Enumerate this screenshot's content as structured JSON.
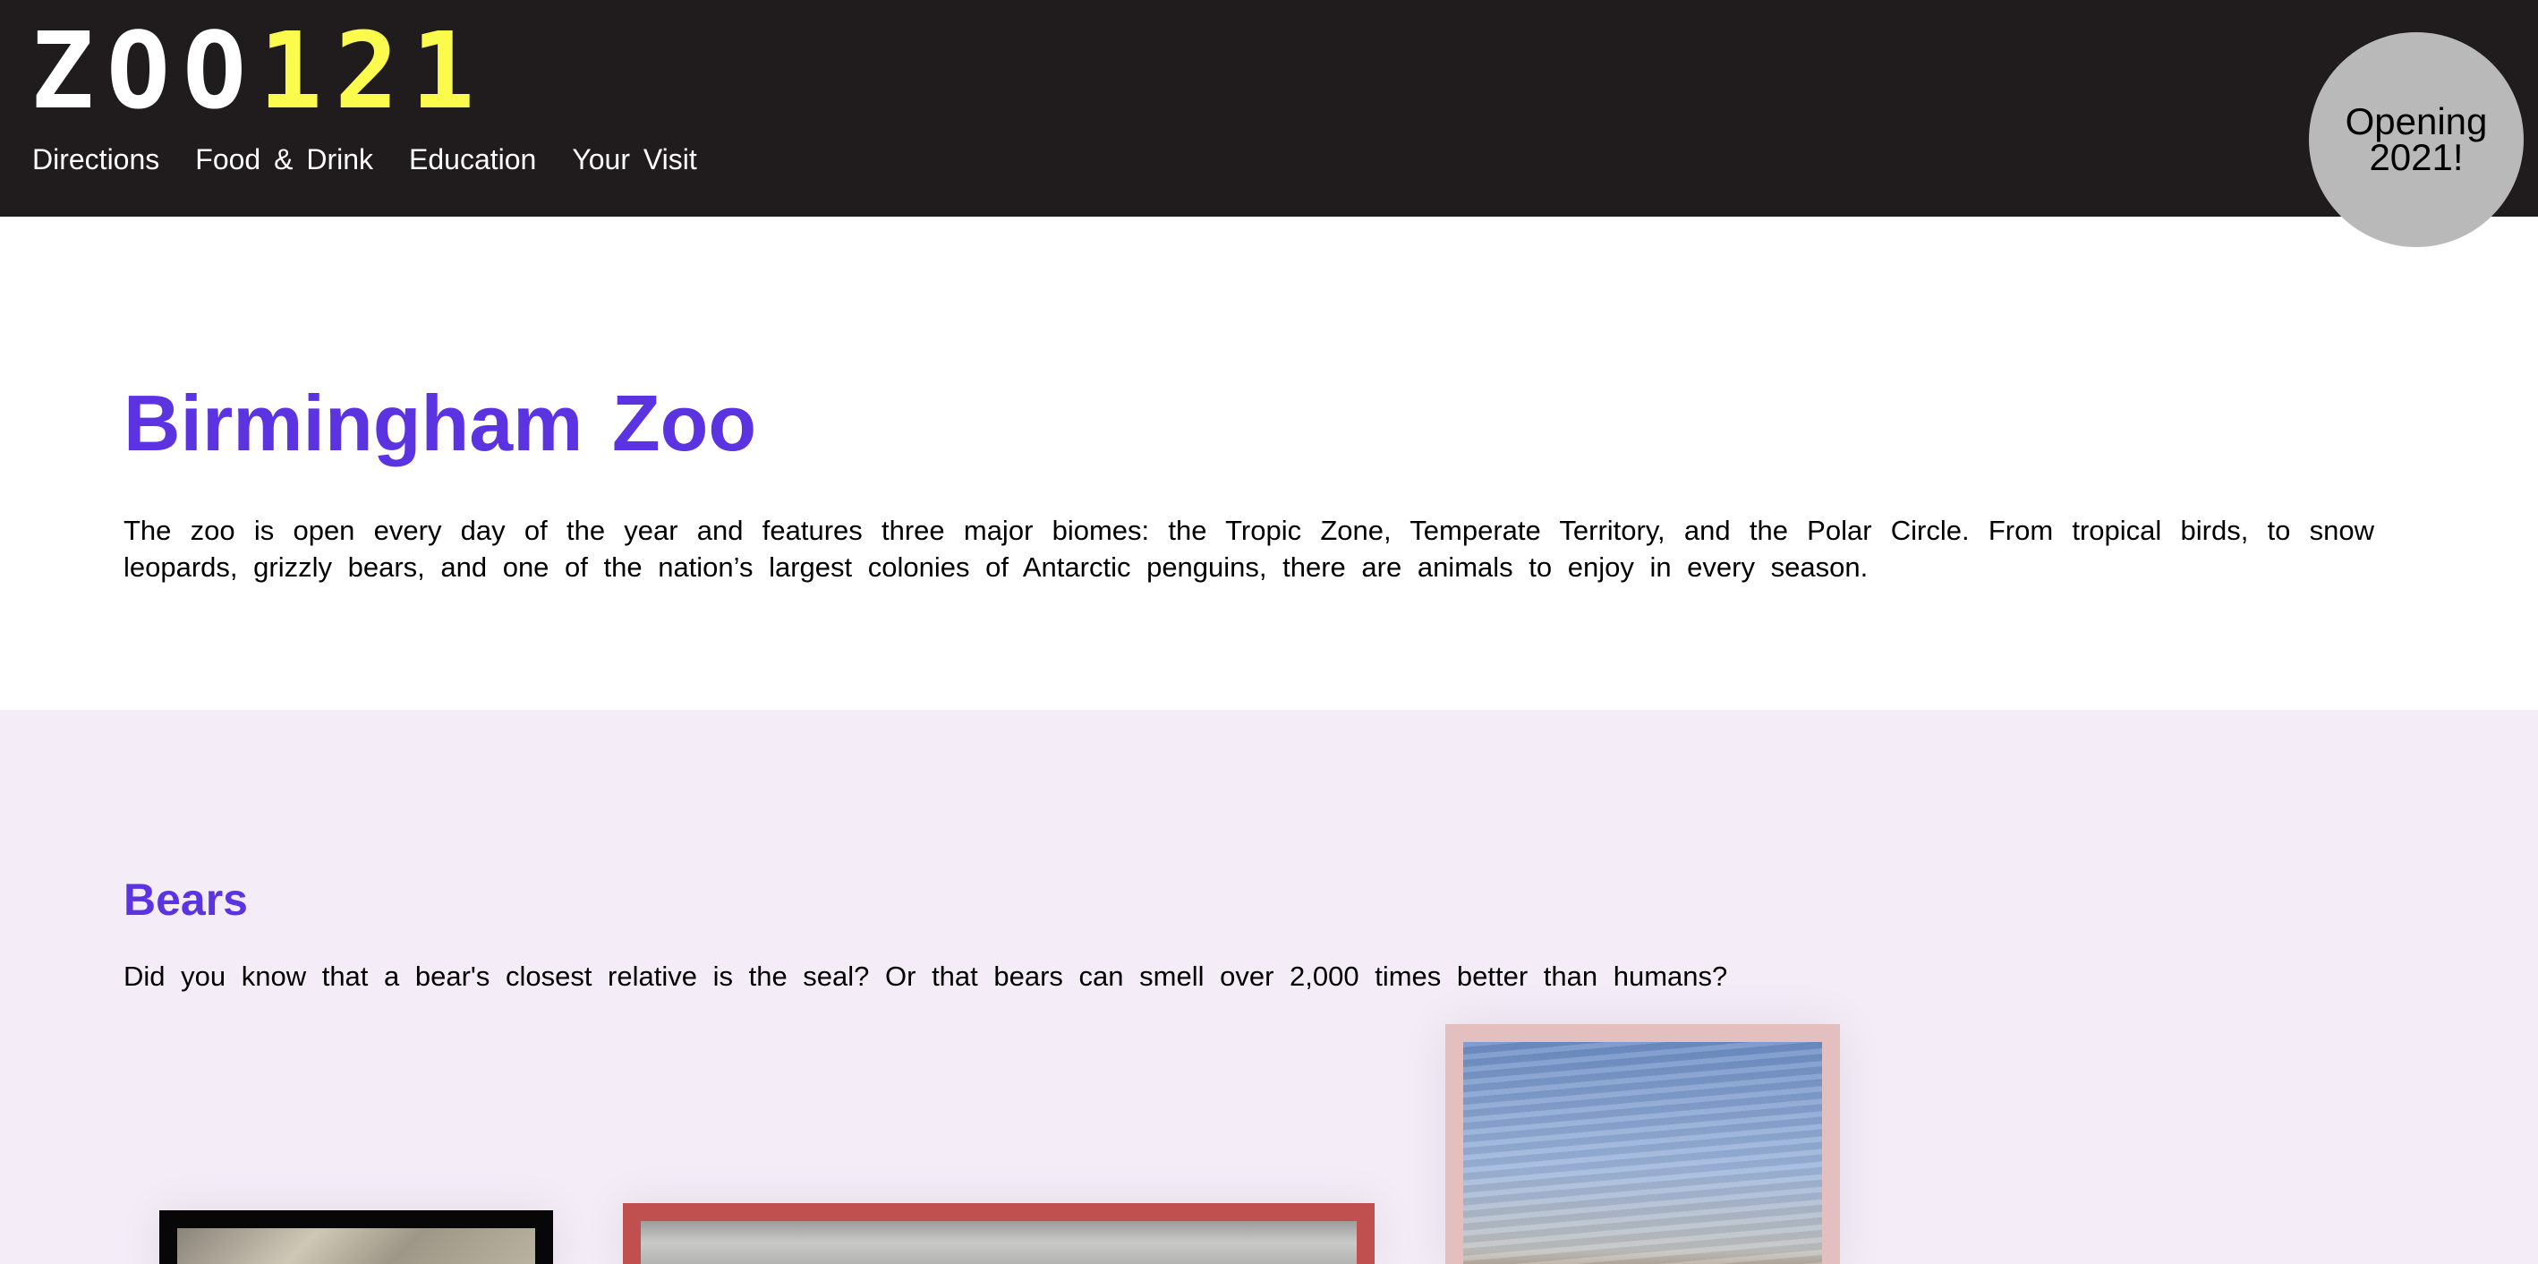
{
  "header": {
    "logo": {
      "part1": "ZOO",
      "part2": "121"
    },
    "nav": [
      {
        "label": "Directions"
      },
      {
        "label": "Food & Drink"
      },
      {
        "label": "Education"
      },
      {
        "label": "Your Visit"
      }
    ],
    "badge": "Opening 2021!"
  },
  "intro": {
    "title": "Birmingham Zoo",
    "text": "The zoo is open every day of the year and features three major biomes: the Tropic Zone, Temperate Territory, and the Polar Circle. From tropical birds, to snow leopards, grizzly bears, and one of the nation’s largest colonies of Antarctic penguins, there are animals to enjoy in every season."
  },
  "bears": {
    "title": "Bears",
    "text": "Did you know that a bear's closest relative is the seal? Or that bears can smell over 2,000 times better than humans?"
  },
  "colors": {
    "header_bg": "#201c1d",
    "logo_accent": "#fbfb4e",
    "heading": "#5b33e0",
    "bears_bg": "#f4edf8",
    "badge_bg": "#b9b9b9",
    "frame_1": "#070707",
    "frame_2": "#c0504f",
    "frame_3": "#e3bfbf"
  }
}
